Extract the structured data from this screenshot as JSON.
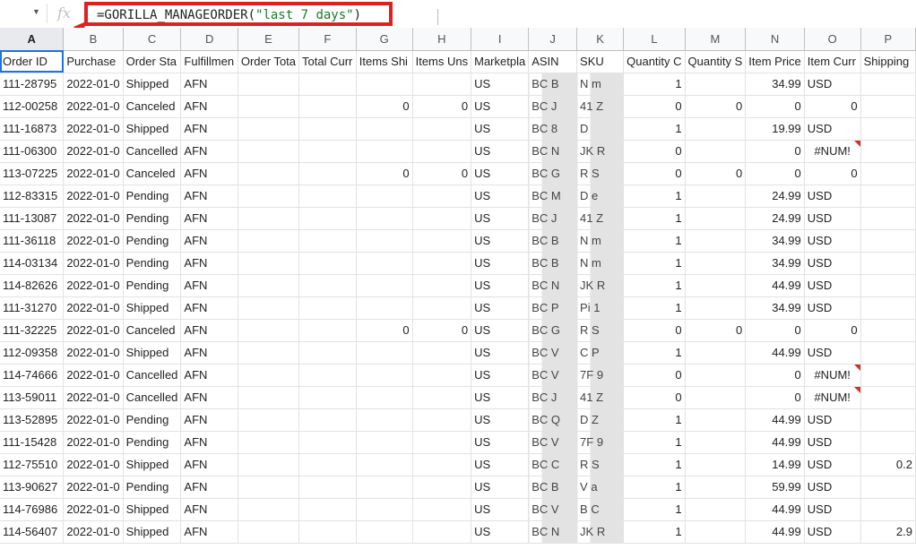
{
  "formula_bar": {
    "fx": "fx",
    "formula_prefix": "=GORILLA_MANAGEORDER(",
    "formula_arg": "\"last 7 days\"",
    "formula_suffix": ")"
  },
  "columns": [
    "A",
    "B",
    "C",
    "D",
    "E",
    "F",
    "G",
    "H",
    "I",
    "J",
    "K",
    "L",
    "M",
    "N",
    "O",
    "P"
  ],
  "header_row": [
    "Order ID",
    "Purchase",
    "Order Sta",
    "Fulfillmen",
    "Order Tota",
    "Total Curr",
    "Items Shi",
    "Items Uns",
    "Marketpla",
    "ASIN",
    "SKU",
    "Quantity C",
    "Quantity S",
    "Item Price",
    "Item Curr",
    "Shipping"
  ],
  "rows": [
    [
      "111-28795",
      "2022-01-0",
      "Shipped",
      "AFN",
      "",
      "",
      "",
      "",
      "US",
      "BC    B",
      "N      m",
      "1",
      "",
      "34.99",
      "USD",
      ""
    ],
    [
      "112-00258",
      "2022-01-0",
      "Canceled",
      "AFN",
      "",
      "",
      "0",
      "0",
      "US",
      "BC    J",
      "41      Z",
      "0",
      "0",
      "0",
      "0",
      ""
    ],
    [
      "111-16873",
      "2022-01-0",
      "Shipped",
      "AFN",
      "",
      "",
      "",
      "",
      "US",
      "BC    8",
      "D",
      "1",
      "",
      "19.99",
      "USD",
      ""
    ],
    [
      "111-06300",
      "2022-01-0",
      "Cancelled",
      "AFN",
      "",
      "",
      "",
      "",
      "US",
      "BC    N",
      "JK      R",
      "0",
      "",
      "0",
      "#NUM!",
      ""
    ],
    [
      "113-07225",
      "2022-01-0",
      "Canceled",
      "AFN",
      "",
      "",
      "0",
      "0",
      "US",
      "BC    G",
      "R      S",
      "0",
      "0",
      "0",
      "0",
      ""
    ],
    [
      "112-83315",
      "2022-01-0",
      "Pending",
      "AFN",
      "",
      "",
      "",
      "",
      "US",
      "BC    M",
      "D      e",
      "1",
      "",
      "24.99",
      "USD",
      ""
    ],
    [
      "111-13087",
      "2022-01-0",
      "Pending",
      "AFN",
      "",
      "",
      "",
      "",
      "US",
      "BC    J",
      "41      Z",
      "1",
      "",
      "24.99",
      "USD",
      ""
    ],
    [
      "111-36118",
      "2022-01-0",
      "Pending",
      "AFN",
      "",
      "",
      "",
      "",
      "US",
      "BC    B",
      "N      m",
      "1",
      "",
      "34.99",
      "USD",
      ""
    ],
    [
      "114-03134",
      "2022-01-0",
      "Pending",
      "AFN",
      "",
      "",
      "",
      "",
      "US",
      "BC    B",
      "N      m",
      "1",
      "",
      "34.99",
      "USD",
      ""
    ],
    [
      "114-82626",
      "2022-01-0",
      "Pending",
      "AFN",
      "",
      "",
      "",
      "",
      "US",
      "BC    N",
      "JK      R",
      "1",
      "",
      "44.99",
      "USD",
      ""
    ],
    [
      "111-31270",
      "2022-01-0",
      "Shipped",
      "AFN",
      "",
      "",
      "",
      "",
      "US",
      "BC    P",
      "Pi      1",
      "1",
      "",
      "34.99",
      "USD",
      ""
    ],
    [
      "111-32225",
      "2022-01-0",
      "Canceled",
      "AFN",
      "",
      "",
      "0",
      "0",
      "US",
      "BC    G",
      "R      S",
      "0",
      "0",
      "0",
      "0",
      ""
    ],
    [
      "112-09358",
      "2022-01-0",
      "Shipped",
      "AFN",
      "",
      "",
      "",
      "",
      "US",
      "BC    V",
      "C      P",
      "1",
      "",
      "44.99",
      "USD",
      ""
    ],
    [
      "114-74666",
      "2022-01-0",
      "Cancelled",
      "AFN",
      "",
      "",
      "",
      "",
      "US",
      "BC    V",
      "7F      9",
      "0",
      "",
      "0",
      "#NUM!",
      ""
    ],
    [
      "113-59011",
      "2022-01-0",
      "Cancelled",
      "AFN",
      "",
      "",
      "",
      "",
      "US",
      "BC    J",
      "41      Z",
      "0",
      "",
      "0",
      "#NUM!",
      ""
    ],
    [
      "113-52895",
      "2022-01-0",
      "Pending",
      "AFN",
      "",
      "",
      "",
      "",
      "US",
      "BC    Q",
      "D      Z",
      "1",
      "",
      "44.99",
      "USD",
      ""
    ],
    [
      "111-15428",
      "2022-01-0",
      "Pending",
      "AFN",
      "",
      "",
      "",
      "",
      "US",
      "BC    V",
      "7F      9",
      "1",
      "",
      "44.99",
      "USD",
      ""
    ],
    [
      "112-75510",
      "2022-01-0",
      "Shipped",
      "AFN",
      "",
      "",
      "",
      "",
      "US",
      "BC    C",
      "R      S",
      "1",
      "",
      "14.99",
      "USD",
      "0.2"
    ],
    [
      "113-90627",
      "2022-01-0",
      "Pending",
      "AFN",
      "",
      "",
      "",
      "",
      "US",
      "BC    B",
      "V      a",
      "1",
      "",
      "59.99",
      "USD",
      ""
    ],
    [
      "114-76986",
      "2022-01-0",
      "Shipped",
      "AFN",
      "",
      "",
      "",
      "",
      "US",
      "BC    V",
      "B      C",
      "1",
      "",
      "44.99",
      "USD",
      ""
    ],
    [
      "114-56407",
      "2022-01-0",
      "Shipped",
      "AFN",
      "",
      "",
      "",
      "",
      "US",
      "BC    N",
      "JK      R",
      "1",
      "",
      "44.99",
      "USD",
      "2.9"
    ]
  ],
  "colors": {
    "highlight": "#e02020",
    "selection": "#1a73e8",
    "error_flag": "#d93025"
  }
}
